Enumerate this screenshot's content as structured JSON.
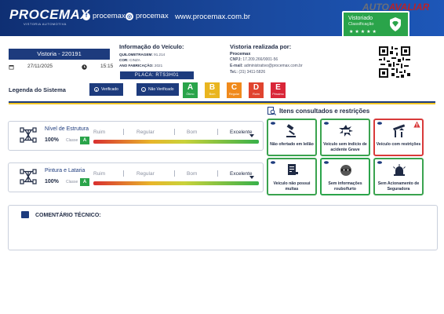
{
  "header": {
    "logo": "PROCEMAX",
    "logo_sub": "VISTORIA AUTOMOTIVA",
    "facebook": "procemax",
    "instagram": "procemax",
    "website": "www.procemax.com.br",
    "badge_title": "Vistoriado",
    "badge_sub": "Classificação",
    "badge_stars": "★★★★★",
    "brand_right_a": "AUTO",
    "brand_right_b": "AVALIAR"
  },
  "vistoria": {
    "label": "Vistoria - 220191",
    "date": "27/11/2025",
    "time": "15:15"
  },
  "vehicle_info": {
    "title": "Informação do Veículo:",
    "km_label": "QUILOMETRAGEM:",
    "km_value": "91.214",
    "color_label": "COR:",
    "color_value": "CINZA",
    "year_label": "ANO FABRICAÇÃO:",
    "year_value": "2021",
    "plate": "PLACA: RTS3H01"
  },
  "vendor": {
    "title": "Vistoria realizada por:",
    "name": "Procemax",
    "cnpj_label": "CNPJ:",
    "cnpj_value": "17.209.266/0001-56",
    "email_label": "E-mail:",
    "email_value": "administrativo@procemax.com.br",
    "tel_label": "Tel.:",
    "tel_value": "(31) 3411-5826"
  },
  "legend": {
    "title": "Legenda do Sistema",
    "verified": "Verificado",
    "not_verified": "Não Verificado",
    "grades": [
      {
        "letter": "A",
        "name": "Ótimo",
        "color": "#2aa44a"
      },
      {
        "letter": "B",
        "name": "Bom",
        "color": "#e9b51f"
      },
      {
        "letter": "C",
        "name": "Regular",
        "color": "#f08a1c"
      },
      {
        "letter": "D",
        "name": "Ruim",
        "color": "#e0442f"
      },
      {
        "letter": "E",
        "name": "Péssimo",
        "color": "#d92638"
      }
    ]
  },
  "scale_labels": [
    "Ruim",
    "Regular",
    "Bom",
    "Excelente"
  ],
  "panels": [
    {
      "title": "Nível de Estrutura",
      "percent": "100%",
      "classe_label": "Classe",
      "grade": "A",
      "level": 1.0
    },
    {
      "title": "Pintura e Lataria",
      "percent": "100%",
      "classe_label": "Classe",
      "grade": "A",
      "level": 1.0
    }
  ],
  "restrictions": {
    "title": "Itens consultados e restrições",
    "items": [
      {
        "label": "Não ofertado em leilão",
        "icon": "gavel-icon",
        "status": "ok"
      },
      {
        "label": "Veículo sem indício de acidente Grave",
        "icon": "crash-icon",
        "status": "ok"
      },
      {
        "label": "Veículo com restrições",
        "icon": "barrier-icon",
        "status": "alert"
      },
      {
        "label": "Veículo não possui multas",
        "icon": "ticket-icon",
        "status": "ok"
      },
      {
        "label": "Sem informações roubo/furto",
        "icon": "mask-icon",
        "status": "ok"
      },
      {
        "label": "Sem Acionamento de Seguradora",
        "icon": "siren-icon",
        "status": "ok"
      }
    ]
  },
  "comment": {
    "title": "COMENTÁRIO TÉCNICO:"
  }
}
